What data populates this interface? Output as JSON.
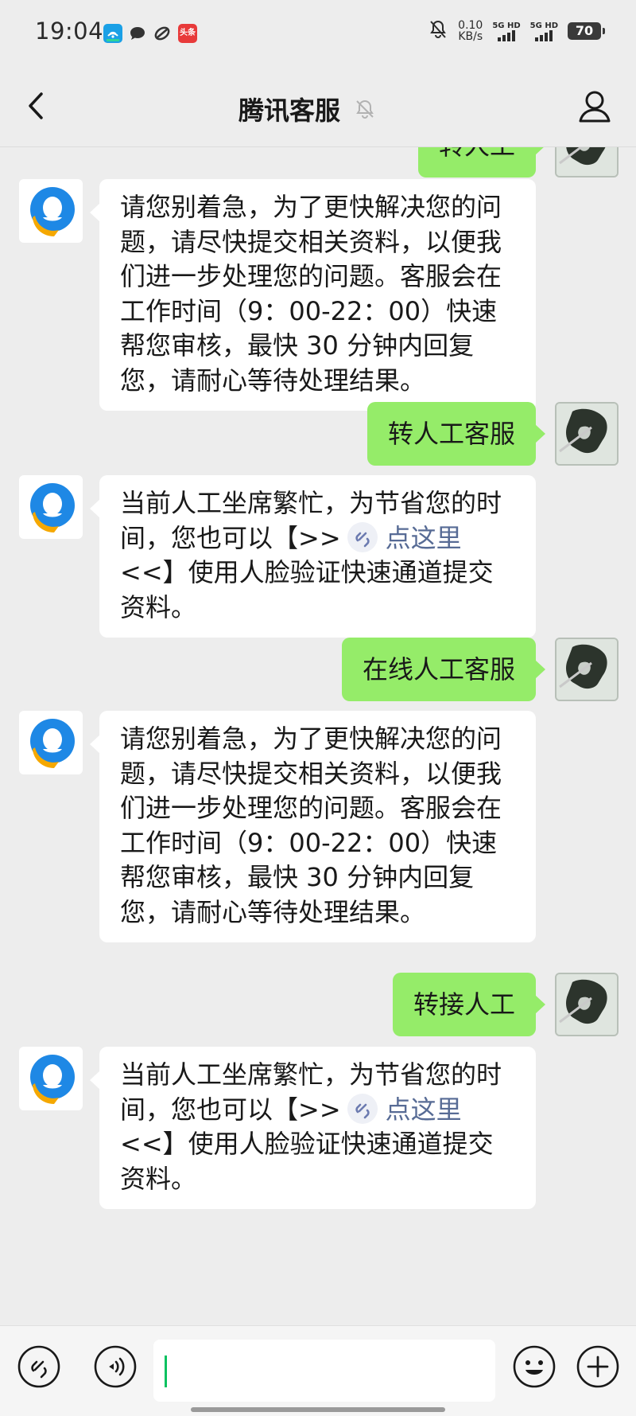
{
  "status_bar": {
    "time": "19:04",
    "net_speed_value": "0.10",
    "net_speed_unit": "KB/s",
    "sim1_label": "5G HD",
    "sim2_label": "5G HD",
    "battery": "70",
    "notif_app_1_label": "头条",
    "icons": [
      "wifi-hotspot-icon",
      "chat-bubble-icon",
      "sync-icon",
      "toutiao-app-icon",
      "mute-icon"
    ]
  },
  "nav": {
    "title": "腾讯客服",
    "back_icon": "chevron-left-icon",
    "mute_icon": "bell-off-icon",
    "profile_icon": "person-icon"
  },
  "messages": [
    {
      "side": "out",
      "text": "转人工"
    },
    {
      "side": "in",
      "text": "请您别着急，为了更快解决您的问题，请尽快提交相关资料，以便我们进一步处理您的问题。客服会在工作时间（9：00-22：00）快速帮您审核，最快 30 分钟内回复您，请耐心等待处理结果。"
    },
    {
      "side": "out",
      "text": "转人工客服"
    },
    {
      "side": "in",
      "text_before": "当前人工坐席繁忙，为节省您的时间，您也可以【>>",
      "link_text": "点这里",
      "text_after": "<<】使用人脸验证快速通道提交资料。"
    },
    {
      "side": "out",
      "text": "在线人工客服"
    },
    {
      "side": "in",
      "text": "请您别着急，为了更快解决您的问题，请尽快提交相关资料，以便我们进一步处理您的问题。客服会在工作时间（9：00-22：00）快速帮您审核，最快 30 分钟内回复您，请耐心等待处理结果。"
    },
    {
      "side": "out",
      "text": "转接人工"
    },
    {
      "side": "in",
      "text_before": "当前人工坐席繁忙，为节省您的时间，您也可以【>>",
      "link_text": "点这里",
      "text_after": "<<】使用人脸验证快速通道提交资料。"
    }
  ],
  "input_bar": {
    "left_icons": [
      "mini-program-icon",
      "voice-icon"
    ],
    "right_icons": [
      "emoji-icon",
      "plus-icon"
    ],
    "input_value": ""
  },
  "colors": {
    "background": "#ededed",
    "outgoing_bubble": "#95ec69",
    "incoming_bubble": "#ffffff",
    "link": "#576b95",
    "caret": "#07c160"
  }
}
